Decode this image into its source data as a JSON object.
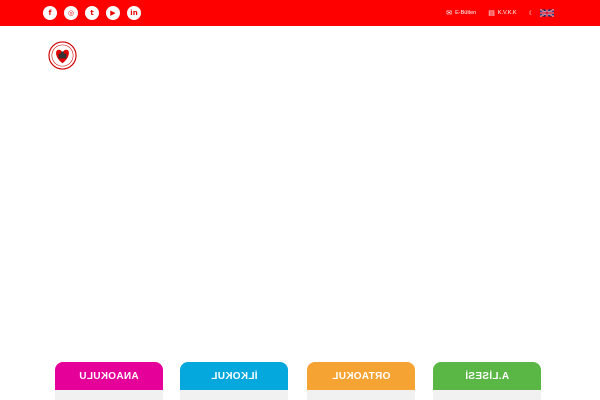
{
  "colors": {
    "topbar": "#ff0000",
    "anaokulu": "#e5009a",
    "ilkokul": "#05a8dd",
    "ortaokul": "#f5a332",
    "lise": "#5ab745"
  },
  "social": [
    {
      "icon": "facebook-icon",
      "glyph": "f"
    },
    {
      "icon": "instagram-icon",
      "glyph": "◎"
    },
    {
      "icon": "twitter-icon",
      "glyph": "t"
    },
    {
      "icon": "youtube-icon",
      "glyph": "▶"
    },
    {
      "icon": "linkedin-icon",
      "glyph": "in"
    }
  ],
  "header": {
    "ebulten_label": "E-Bülten",
    "kvkk_label": "K.V.K.K",
    "lang_tr": "☾"
  },
  "cards": [
    {
      "label": "ANAOKULU"
    },
    {
      "label": "İLKOKUL"
    },
    {
      "label": "ORTAOKUL"
    },
    {
      "label": "A.LİSESİ"
    }
  ]
}
